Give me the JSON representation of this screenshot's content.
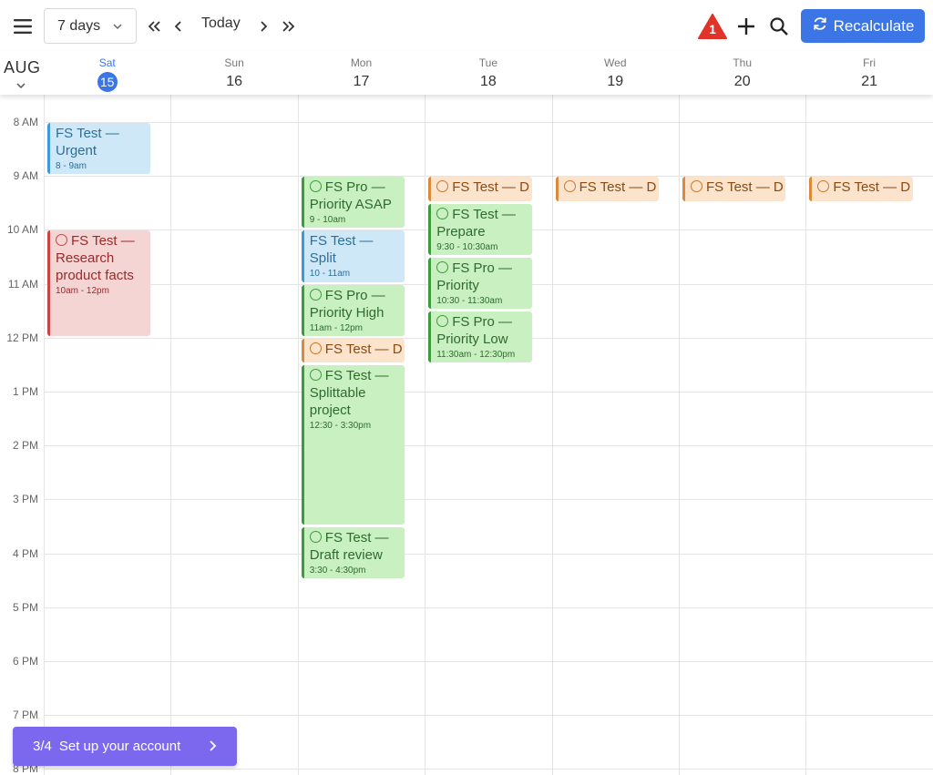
{
  "toolbar": {
    "range_value": "7 days",
    "today_label": "Today",
    "alert_count": "1",
    "recalculate_label": "Recalculate"
  },
  "header": {
    "month": "AUG",
    "days": [
      {
        "dow": "Sat",
        "num": "15",
        "today": true
      },
      {
        "dow": "Sun",
        "num": "16"
      },
      {
        "dow": "Mon",
        "num": "17"
      },
      {
        "dow": "Tue",
        "num": "18"
      },
      {
        "dow": "Wed",
        "num": "19"
      },
      {
        "dow": "Thu",
        "num": "20"
      },
      {
        "dow": "Fri",
        "num": "21"
      }
    ]
  },
  "time_labels": [
    "8 AM",
    "9 AM",
    "10 AM",
    "11 AM",
    "12 PM",
    "1 PM",
    "2 PM",
    "3 PM",
    "4 PM",
    "5 PM",
    "6 PM",
    "7 PM",
    "8 PM"
  ],
  "events": [
    {
      "day": 0,
      "start": 8,
      "end": 9,
      "color": "blue",
      "title": "FS Test — Urgent",
      "time": "8 - 9am",
      "circle": false
    },
    {
      "day": 0,
      "start": 10,
      "end": 12,
      "color": "red",
      "title": "FS Test — Research product facts",
      "time": "10am - 12pm",
      "circle": true
    },
    {
      "day": 2,
      "start": 9,
      "end": 10,
      "color": "green",
      "title": "FS Pro — Priority ASAP",
      "time": "9 - 10am",
      "circle": true
    },
    {
      "day": 2,
      "start": 10,
      "end": 11,
      "color": "blue",
      "title": "FS Test — Split",
      "time": "10 - 11am",
      "circle": false
    },
    {
      "day": 2,
      "start": 11,
      "end": 12,
      "color": "green",
      "title": "FS Pro — Priority High",
      "time": "11am - 12pm",
      "circle": true
    },
    {
      "day": 2,
      "start": 12,
      "end": 12.5,
      "color": "orange",
      "title": "FS Test — D",
      "time": "",
      "circle": true,
      "single": true
    },
    {
      "day": 2,
      "start": 12.5,
      "end": 15.5,
      "color": "green",
      "title": "FS Test — Splittable project",
      "time": "12:30 - 3:30pm",
      "circle": true
    },
    {
      "day": 2,
      "start": 15.5,
      "end": 16.5,
      "color": "green",
      "title": "FS Test — Draft review",
      "time": "3:30 - 4:30pm",
      "circle": true
    },
    {
      "day": 3,
      "start": 9,
      "end": 9.5,
      "color": "orange",
      "title": "FS Test — D",
      "time": "",
      "circle": true,
      "single": true
    },
    {
      "day": 3,
      "start": 9.5,
      "end": 10.5,
      "color": "green",
      "title": "FS Test — Prepare",
      "time": "9:30 - 10:30am",
      "circle": true
    },
    {
      "day": 3,
      "start": 10.5,
      "end": 11.5,
      "color": "green",
      "title": "FS Pro — Priority",
      "time": "10:30 - 11:30am",
      "circle": true
    },
    {
      "day": 3,
      "start": 11.5,
      "end": 12.5,
      "color": "green",
      "title": "FS Pro — Priority Low",
      "time": "11:30am - 12:30pm",
      "circle": true
    },
    {
      "day": 4,
      "start": 9,
      "end": 9.5,
      "color": "orange",
      "title": "FS Test — D",
      "time": "",
      "circle": true,
      "single": true
    },
    {
      "day": 5,
      "start": 9,
      "end": 9.5,
      "color": "orange",
      "title": "FS Test — D",
      "time": "",
      "circle": true,
      "single": true
    },
    {
      "day": 6,
      "start": 9,
      "end": 9.5,
      "color": "orange",
      "title": "FS Test — D",
      "time": "",
      "circle": true,
      "single": true
    }
  ],
  "setup": {
    "progress": "3/4",
    "label": "Set up your account"
  }
}
